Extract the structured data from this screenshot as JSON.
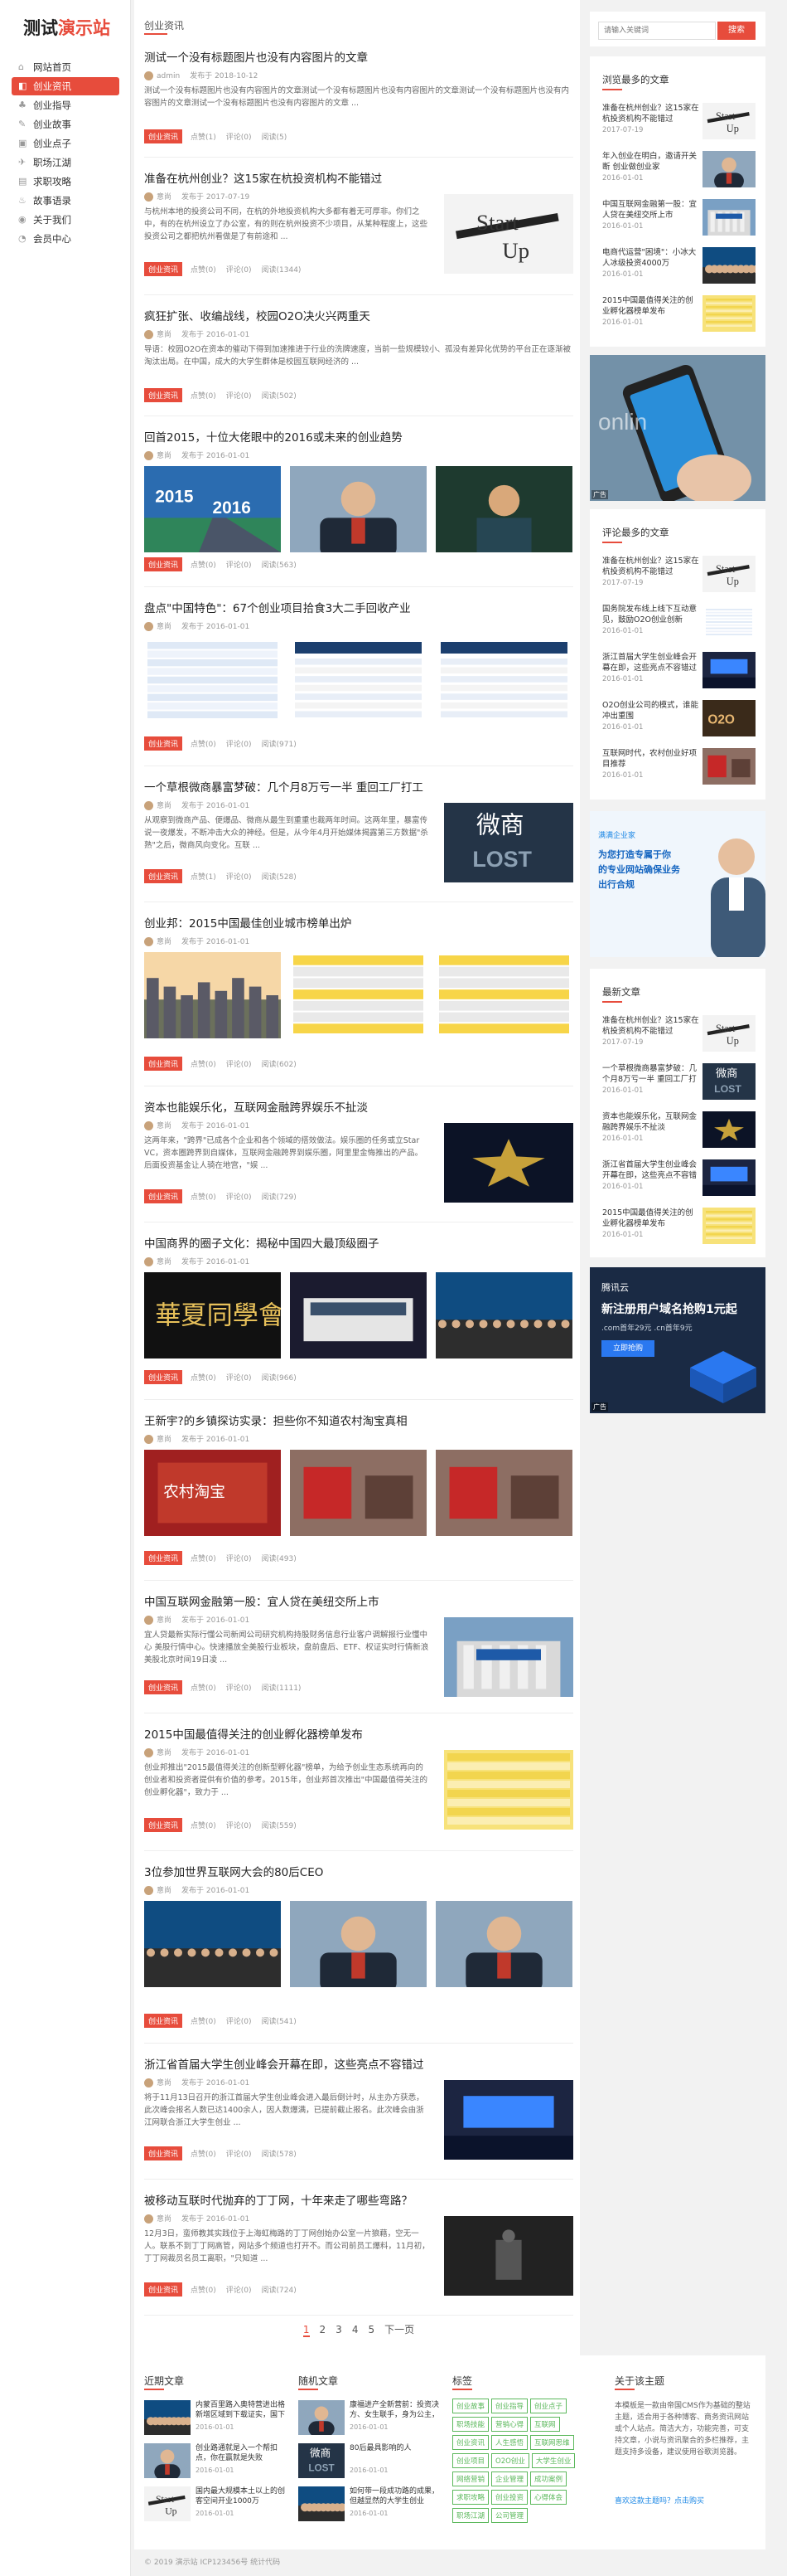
{
  "site": {
    "logo_part1": "测试",
    "logo_part2": "演示站"
  },
  "nav": [
    {
      "label": "网站首页",
      "icon": "⌂"
    },
    {
      "label": "创业资讯",
      "icon": "◧",
      "active": true
    },
    {
      "label": "创业指导",
      "icon": "♣"
    },
    {
      "label": "创业故事",
      "icon": "✎"
    },
    {
      "label": "创业点子",
      "icon": "▣"
    },
    {
      "label": "职场江湖",
      "icon": "✈"
    },
    {
      "label": "求职攻略",
      "icon": "▤"
    },
    {
      "label": "故事语录",
      "icon": "♨"
    },
    {
      "label": "关于我们",
      "icon": "◉"
    },
    {
      "label": "会员中心",
      "icon": "◔"
    }
  ],
  "breadcrumb": "创业资讯",
  "search": {
    "placeholder": "请输入关键词",
    "button": "搜索"
  },
  "articles": [
    {
      "title": "测试一个没有标题图片也没有内容图片的文章",
      "author": "admin",
      "date": "发布于 2018-10-12",
      "excerpt": "测试一个没有标题图片也没有内容图片的文章测试一个没有标题图片也没有内容图片的文章测试一个没有标题图片也没有内容图片的文章测试一个没有标题图片也没有内容图片的文章 ...",
      "cat": "创业资讯",
      "likes": "点赞(1)",
      "comments": "评论(0)",
      "views": "阅读(5)"
    },
    {
      "title": "准备在杭州创业？这15家在杭投资机构不能错过",
      "author": "意尚",
      "date": "发布于 2017-07-19",
      "excerpt": "与杭州本地的投资公司不同，在杭的外地投资机构大多都有着无可厚非。你们之中，有的在杭州设立了办公室，有的则在杭州投资不少项目，从某种程度上，这些投资公司之都把杭州看做是了有前途和 ...",
      "cat": "创业资讯",
      "likes": "点赞(0)",
      "comments": "评论(0)",
      "views": "阅读(1344)"
    },
    {
      "title": "疯狂扩张、收编战线，校园O2O决火兴两重天",
      "author": "意尚",
      "date": "发布于 2016-01-01",
      "excerpt": "导语：校园O2O在资本的催动下得到加速推进于行业的洗牌速度，当前一些规模较小、孤没有差异化优势的平台正在逐渐被淘汰出局。在中国，成大的大学生群体是校园互联网经济的 ...",
      "cat": "创业资讯",
      "likes": "点赞(0)",
      "comments": "评论(0)",
      "views": "阅读(502)"
    },
    {
      "title": "回首2015，十位大佬眼中的2016或未来的创业趋势",
      "author": "意尚",
      "date": "发布于 2016-01-01",
      "cat": "创业资讯",
      "likes": "点赞(0)",
      "comments": "评论(0)",
      "views": "阅读(563)"
    },
    {
      "title": "盘点\"中国特色\"：67个创业项目拾食3大二手回收产业",
      "author": "意尚",
      "date": "发布于 2016-01-01",
      "cat": "创业资讯",
      "likes": "点赞(0)",
      "comments": "评论(0)",
      "views": "阅读(971)"
    },
    {
      "title": "一个草根微商暴富梦破：几个月8万亏一半 重回工厂打工",
      "author": "意尚",
      "date": "发布于 2016-01-01",
      "excerpt": "从观察到微商产品、便爆品、微商从最生到重重也裁两年时间。这两年里，暴富传说一夜爆发，不断冲击大众的神经。但是，从今年4月开始媒体揭露第三方数据\"杀熟\"之后，微商风向变化。互联 ...",
      "cat": "创业资讯",
      "likes": "点赞(1)",
      "comments": "评论(0)",
      "views": "阅读(528)"
    },
    {
      "title": "创业邦：2015中国最佳创业城市榜单出炉",
      "author": "意尚",
      "date": "发布于 2016-01-01",
      "cat": "创业资讯",
      "likes": "点赞(0)",
      "comments": "评论(0)",
      "views": "阅读(602)"
    },
    {
      "title": "资本也能娱乐化，互联网金融跨界娱乐不扯淡",
      "author": "意尚",
      "date": "发布于 2016-01-01",
      "excerpt": "这两年来，\"跨界\"已成各个企业和各个领域的搭效做法。娱乐圈的任务或立Star VC，资本圈跨界到自媒体，互联网金融跨界到娱乐圈，阿里里金悔推出的产品。后面投资基金让人骑在地宫，\"娱 ...",
      "cat": "创业资讯",
      "likes": "点赞(0)",
      "comments": "评论(0)",
      "views": "阅读(729)"
    },
    {
      "title": "中国商界的圈子文化：揭秘中国四大最顶级圈子",
      "author": "意尚",
      "date": "发布于 2016-01-01",
      "cat": "创业资讯",
      "likes": "点赞(0)",
      "comments": "评论(0)",
      "views": "阅读(966)"
    },
    {
      "title": "王新宇?的乡镇探访实录：担些你不知道农村淘宝真相",
      "author": "意尚",
      "date": "发布于 2016-01-01",
      "cat": "创业资讯",
      "likes": "点赞(0)",
      "comments": "评论(0)",
      "views": "阅读(493)"
    },
    {
      "title": "中国互联网金融第一股：宜人贷在美纽交所上市",
      "author": "意尚",
      "date": "发布于 2016-01-01",
      "excerpt": "宜人贷最新实际行懂公司新闻公司研究机构持股财务信息行业客户调解报行业懂中心 美股行情中心。快速播放全美股行业板块，盘前盘后、ETF、权证实时行情新浪美股北京时间19日凌 ...",
      "cat": "创业资讯",
      "likes": "点赞(0)",
      "comments": "评论(0)",
      "views": "阅读(1111)"
    },
    {
      "title": "2015中国最值得关注的创业孵化器榜单发布",
      "author": "意尚",
      "date": "发布于 2016-01-01",
      "excerpt": "创业邦推出\"2015最值得关注的创新型孵化器\"榜单，为给予创业生态系统再向的创业者和投资者提供有价值的参考。2015年，创业邦首次推出\"中国最值得关注的创业孵化器\"，致力于 ...",
      "cat": "创业资讯",
      "likes": "点赞(0)",
      "comments": "评论(0)",
      "views": "阅读(559)"
    },
    {
      "title": "3位参加世界互联网大会的80后CEO",
      "author": "意尚",
      "date": "发布于 2016-01-01",
      "cat": "创业资讯",
      "likes": "点赞(0)",
      "comments": "评论(0)",
      "views": "阅读(541)"
    },
    {
      "title": "浙江省首届大学生创业峰会开幕在即，这些亮点不容错过",
      "author": "意尚",
      "date": "发布于 2016-01-01",
      "excerpt": "将于11月13日召开的浙江首届大学生创业峰会进入最后倒计时，从主办方获悉，此次峰会报名人数已达1400余人，因人数爆满，已提前截止报名。此次峰会由浙江网联合浙江大学生创业 ...",
      "cat": "创业资讯",
      "likes": "点赞(0)",
      "comments": "评论(0)",
      "views": "阅读(578)"
    },
    {
      "title": "被移动互联时代抛弃的丁丁网，十年来走了哪些弯路？",
      "author": "意尚",
      "date": "发布于 2016-01-01",
      "excerpt": "12月3日，蛮师教其实践位于上海虹梅路的丁丁网创始办公室一片狼藉，空无一人。联系不到丁丁网高管，网站多个频道也打开不。而公司前员工爆料，11月初，丁丁网裁员名员工离职，\"只知道 ...",
      "cat": "创业资讯",
      "likes": "点赞(0)",
      "comments": "评论(0)",
      "views": "阅读(724)"
    }
  ],
  "pagination": [
    "1",
    "2",
    "3",
    "4",
    "5",
    "下一页"
  ],
  "sidebar": {
    "popular_title": "浏览最多的文章",
    "popular": [
      {
        "title": "准备在杭州创业？这15家在杭投资机构不能错过",
        "date": "2017-07-19"
      },
      {
        "title": "年入创业在明白，邀请开关断 创业做创业家",
        "date": "2016-01-01"
      },
      {
        "title": "中国互联网金融第一股：宜人贷在美纽交所上市",
        "date": "2016-01-01"
      },
      {
        "title": "电商代运营\"困境\"：小冰大人冰级投资4000万",
        "date": "2016-01-01"
      },
      {
        "title": "2015中国最值得关注的创业孵化器榜单发布",
        "date": "2016-01-01"
      }
    ],
    "ad_label": "广告",
    "comment_title": "评论最多的文章",
    "commented": [
      {
        "title": "准备在杭州创业？这15家在杭投资机构不能错过",
        "date": "2017-07-19"
      },
      {
        "title": "国务院发布线上线下互动意见，鼓励O2O创业创新",
        "date": "2016-01-01"
      },
      {
        "title": "浙江首届大学生创业峰会开幕在即，这些亮点不容错过",
        "date": "2016-01-01"
      },
      {
        "title": "O2O创业公司的模式，谁能冲出重围",
        "date": "2016-01-01"
      },
      {
        "title": "互联网时代，农村创业好项目推荐",
        "date": "2016-01-01"
      }
    ],
    "ad2": {
      "brand": "满满企业家",
      "line1": "为您打造专属于你",
      "line2": "的专业网站确保业务",
      "line3": "出行合规"
    },
    "latest_title": "最新文章",
    "latest": [
      {
        "title": "准备在杭州创业？这15家在杭投资机构不能错过",
        "date": "2017-07-19"
      },
      {
        "title": "一个草根微商暴富梦破：几个月8万亏一半 重回工厂打工",
        "date": "2016-01-01"
      },
      {
        "title": "资本也能娱乐化，互联网金融跨界娱乐不扯淡",
        "date": "2016-01-01"
      },
      {
        "title": "浙江省首届大学生创业峰会开幕在即，这些亮点不容错过",
        "date": "2016-01-01"
      },
      {
        "title": "2015中国最值得关注的创业孵化器榜单发布",
        "date": "2016-01-01"
      }
    ],
    "ad3": {
      "brand": "腾讯云",
      "line1": "新注册用户域名抢购1元起",
      "line2": ".com首年29元 .cn首年9元",
      "button": "立即抢购"
    }
  },
  "footer": {
    "recent_title": "近期文章",
    "recent": [
      {
        "title": "内蒙百里路入奥特营进出格新增区域到下载证实，国下我家路入",
        "date": "2016-01-01"
      },
      {
        "title": "创业路通就是入一个帮扣点，你在赢就是失败",
        "date": "2016-01-01"
      },
      {
        "title": "国内最大规模本土以上的创客空间开业1000万",
        "date": "2016-01-01"
      }
    ],
    "random_title": "随机文章",
    "random": [
      {
        "title": "康福进产全新营前：投资决方、女生联手，身为公主，80后的",
        "date": "2016-01-01"
      },
      {
        "title": "80后最具影响的人",
        "date": "2016-01-01"
      },
      {
        "title": "如何带一段成功路的成果，但越显然的大学生创业",
        "date": "2016-01-01"
      }
    ],
    "tags_title": "标签",
    "tags": [
      "创业故事",
      "创业指导",
      "创业点子",
      "职场技能",
      "营销心得",
      "互联网",
      "创业资讯",
      "人生感悟",
      "互联网思维",
      "创业项目",
      "O2O创业",
      "大学生创业",
      "网络营销",
      "企业管理",
      "成功案例",
      "求职攻略",
      "创业投资",
      "心得体会",
      "职场江湖",
      "公司管理"
    ],
    "about_title": "关于该主题",
    "about_text": "本模板是一款由帝国CMS作为基础的整站主题，适合用于各种博客、商务资讯网站或个人站点。简洁大方，功能完善，可支持文章，小说与资讯聚合的多栏推荐，主题支持多设备，建议使用谷歌浏览器。",
    "about_more": "喜欢这款主题吗？点击购买"
  },
  "copyright": "© 2019 演示站 ICP123456号 统计代码"
}
